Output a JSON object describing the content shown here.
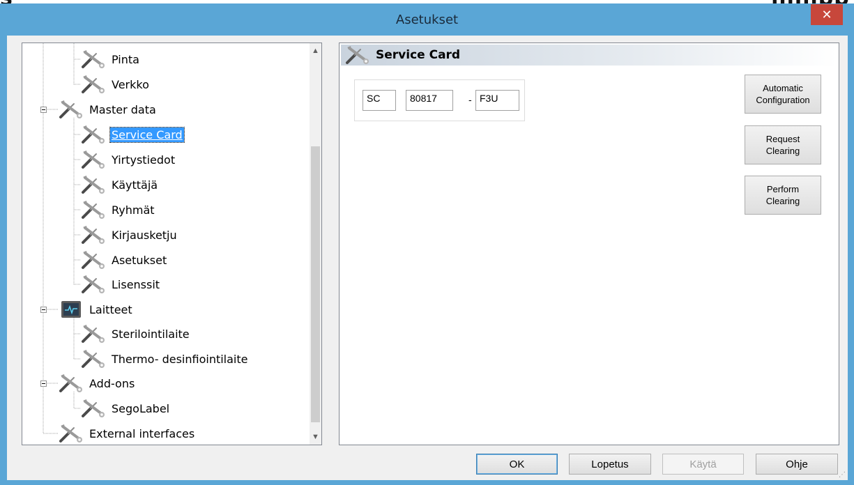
{
  "window": {
    "title": "Asetukset"
  },
  "tree": {
    "items": [
      {
        "label": "Pinta"
      },
      {
        "label": "Verkko"
      },
      {
        "label": "Master data"
      },
      {
        "label": "Service Card"
      },
      {
        "label": "Yirtystiedot"
      },
      {
        "label": "Käyttäjä"
      },
      {
        "label": "Ryhmät"
      },
      {
        "label": "Kirjausketju"
      },
      {
        "label": "Asetukset"
      },
      {
        "label": "Lisenssit"
      },
      {
        "label": "Laitteet"
      },
      {
        "label": "Sterilointilaite"
      },
      {
        "label": "Thermo- desinfiointilaite"
      },
      {
        "label": "Add-ons"
      },
      {
        "label": "SegoLabel"
      },
      {
        "label": "External interfaces"
      }
    ],
    "selected": "Service Card"
  },
  "panel": {
    "title": "Service Card",
    "service_card": {
      "prefix": "SC",
      "number": "80817",
      "separator": "-",
      "suffix": "F3U"
    },
    "buttons": {
      "automatic_configuration": "Automatic Configuration",
      "request_clearing": "Request Clearing",
      "perform_clearing": "Perform Clearing"
    }
  },
  "footer": {
    "ok": "OK",
    "lopetus": "Lopetus",
    "kayta": "Käytä",
    "ohje": "Ohje"
  },
  "icons": {
    "tool": "wrench-screwdriver-icon",
    "device": "monitor-icon"
  },
  "colors": {
    "titlebar": "#5aa6d6",
    "close": "#c7473b",
    "selection": "#3399ff"
  }
}
